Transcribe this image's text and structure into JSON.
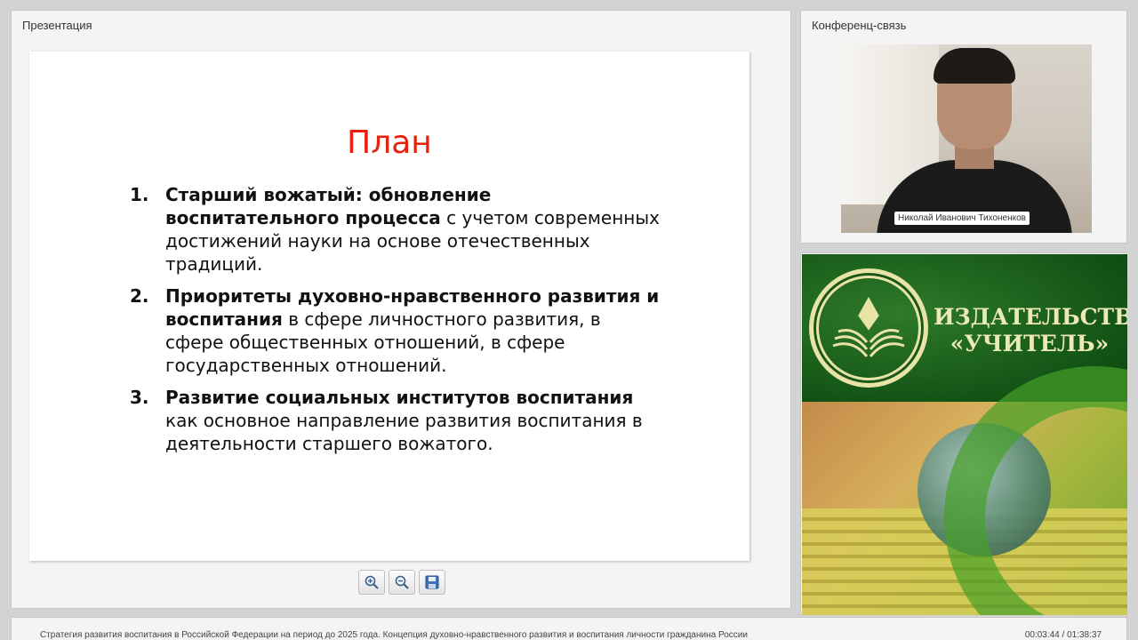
{
  "presentation": {
    "panel_title": "Презентация",
    "slide": {
      "title": "План",
      "items": [
        {
          "number": "1.",
          "bold": "Старший вожатый: обновление воспитательного процесса",
          "rest": " с учетом современных достижений науки на основе отечественных традиций."
        },
        {
          "number": "2.",
          "bold": "Приоритеты духовно-нравственного развития и воспитания",
          "rest": " в сфере личностного развития, в сфере общественных отношений, в сфере государственных отношений."
        },
        {
          "number": "3.",
          "bold": "Развитие социальных институтов воспитания",
          "rest": " как основное направление развития воспитания в деятельности старшего вожатого."
        }
      ]
    },
    "toolbar": [
      {
        "name": "zoom-in-button",
        "icon": "zoom-in-icon"
      },
      {
        "name": "zoom-out-button",
        "icon": "zoom-out-icon"
      },
      {
        "name": "save-button",
        "icon": "save-icon"
      }
    ]
  },
  "conference": {
    "panel_title": "Конференц-связь",
    "participant_name": "Николай Иванович Тихоненков"
  },
  "ad": {
    "line1": "ИЗДАТЕЛЬСТВО",
    "line2": "«УЧИТЕЛЬ»"
  },
  "status": {
    "text": "Стратегия развития воспитания в Российской Федерации на период до 2025 года. Концепция духовно-нравственного развития и воспитания личности гражданина России",
    "time": "00:03:44 / 01:38:37"
  },
  "colors": {
    "slide_title": "#e8200c",
    "ad_green": "#0f4f12",
    "ad_text": "#ece9b6"
  }
}
